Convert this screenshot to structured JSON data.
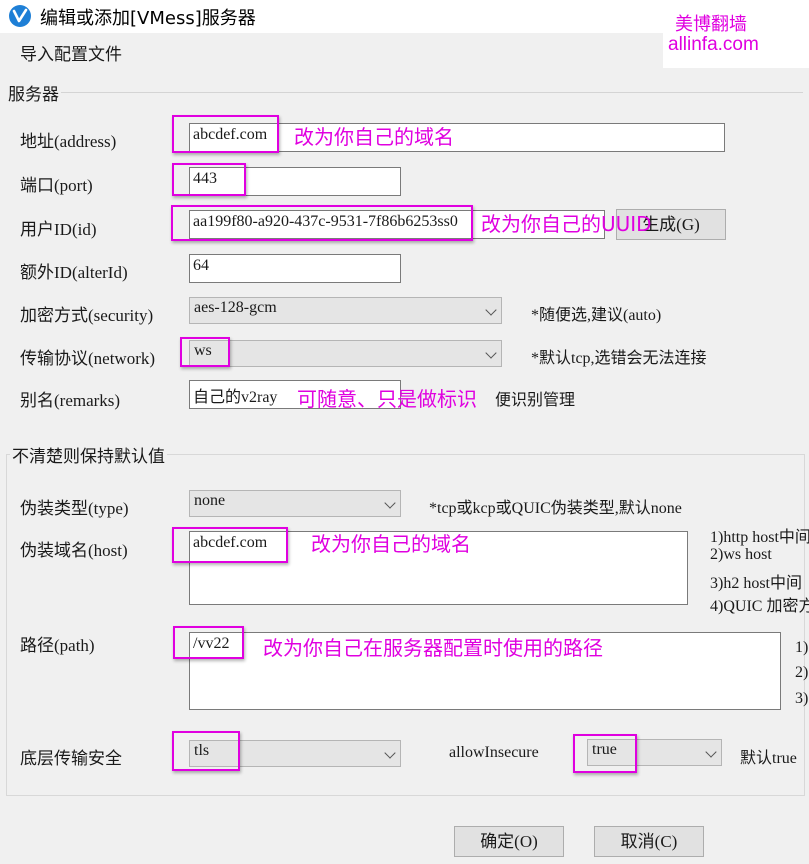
{
  "window": {
    "title": "编辑或添加[VMess]服务器"
  },
  "watermark": {
    "line1": "美博翻墙",
    "line2": "allinfa.com"
  },
  "menu": {
    "import_label": "导入配置文件"
  },
  "server_group": {
    "title": "服务器",
    "address": {
      "label": "地址(address)",
      "value": "abcdef.com"
    },
    "port": {
      "label": "端口(port)",
      "value": "443"
    },
    "user_id": {
      "label": "用户ID(id)",
      "value": "aa199f80-a920-437c-9531-7f86b6253ss0",
      "generate_label": "生成(G)"
    },
    "alter_id": {
      "label": "额外ID(alterId)",
      "value": "64"
    },
    "security": {
      "label": "加密方式(security)",
      "value": "aes-128-gcm",
      "note": "*随便选,建议(auto)"
    },
    "network": {
      "label": "传输协议(network)",
      "value": "ws",
      "note": "*默认tcp,选错会无法连接"
    },
    "remarks": {
      "label": "别名(remarks)",
      "value": "自己的v2ray",
      "tail": "便识别管理"
    }
  },
  "advanced_group": {
    "title": "不清楚则保持默认值",
    "type": {
      "label": "伪装类型(type)",
      "value": "none",
      "note": "*tcp或kcp或QUIC伪装类型,默认none"
    },
    "host": {
      "label": "伪装域名(host)",
      "value": "abcdef.com",
      "hints": [
        "1)http host中间",
        "2)ws host",
        "3)h2 host中间",
        "4)QUIC 加密方"
      ]
    },
    "path": {
      "label": "路径(path)",
      "value": "/vv22",
      "hints": [
        "1)",
        "2)",
        "3)"
      ]
    },
    "tls": {
      "label": "底层传输安全",
      "value": "tls"
    },
    "allow_insecure": {
      "label": "allowInsecure",
      "value": "true",
      "note": "默认true"
    }
  },
  "buttons": {
    "ok": "确定(O)",
    "cancel": "取消(C)"
  },
  "annotations": {
    "address": "改为你自己的域名",
    "uuid": "改为你自己的UUID",
    "remarks": "可随意、只是做标识",
    "host": "改为你自己的域名",
    "path": "改为你自己在服务器配置时使用的路径"
  },
  "colors": {
    "highlight": "#e000e0",
    "accent_icon": "#1e7fd6"
  }
}
